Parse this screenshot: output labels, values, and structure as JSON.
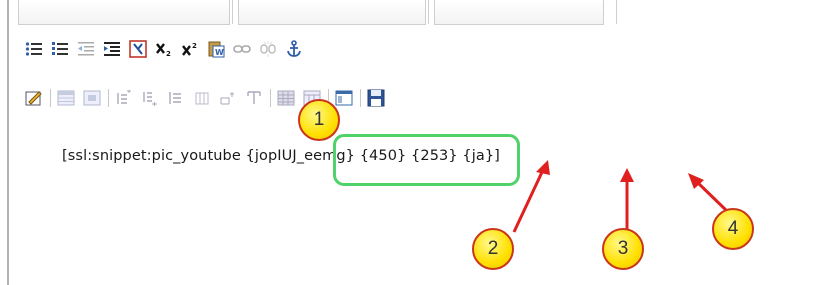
{
  "editor": {
    "text_prefix": "[ssl:snippet:pic_youtube ",
    "text_video_id": "{jopIUJ_eemg}",
    "text_params": " {450} {253} {ja}]"
  },
  "annotations": {
    "marker_1": "1",
    "marker_2": "2",
    "marker_3": "3",
    "marker_4": "4"
  },
  "colors": {
    "highlight": "#4fd26a",
    "marker_fill": "#ffe000",
    "marker_border": "#c9361b",
    "arrow": "#e01f1f"
  },
  "toolbar_row1": [
    "unordered-list-icon",
    "ordered-list-icon",
    "outdent-icon",
    "indent-icon",
    "remove-format-icon",
    "subscript-icon",
    "superscript-icon",
    "paste-word-icon",
    "link-icon",
    "unlink-icon",
    "anchor-icon"
  ],
  "toolbar_row2": [
    "edit-icon",
    "table-icon",
    "table-cell-icon",
    "row-before-icon",
    "row-after-icon",
    "delete-row-icon",
    "col-before-icon",
    "col-after-icon",
    "delete-col-icon",
    "split-cells-icon",
    "merge-cells-icon",
    "template-icon",
    "save-icon"
  ]
}
